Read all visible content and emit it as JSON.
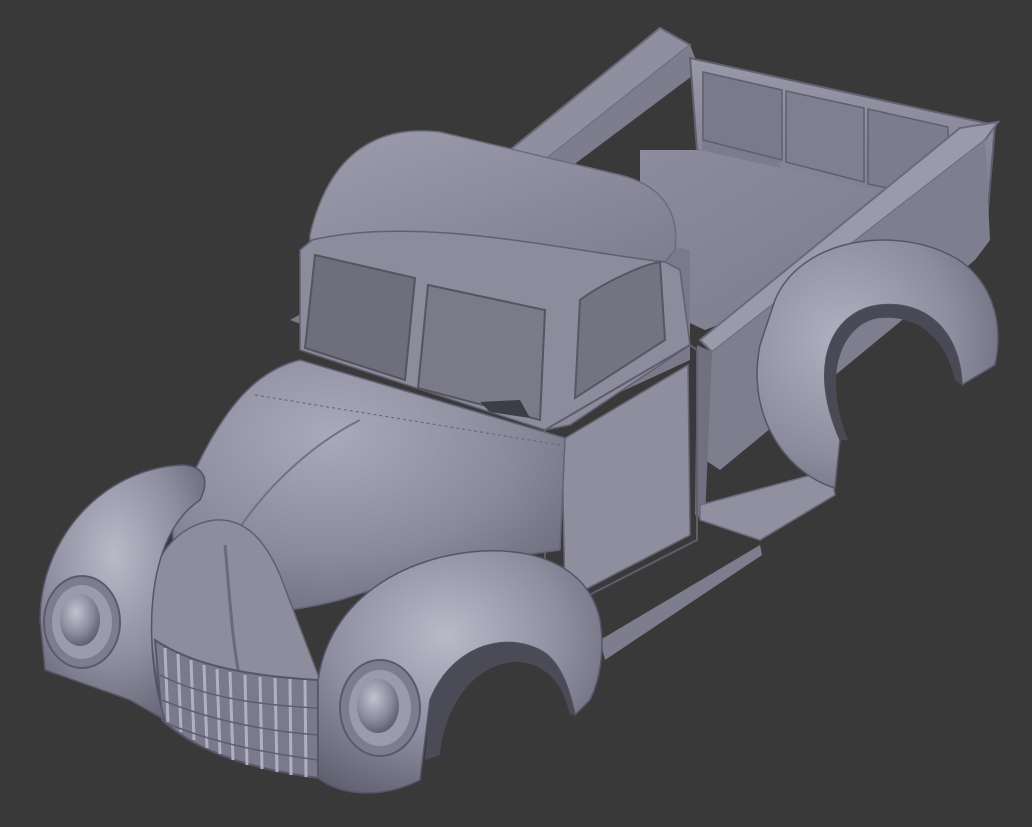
{
  "viewport": {
    "background_color": "#393939",
    "model": "vintage-pickup-truck-body",
    "shading": "solid-matcap",
    "colors": {
      "body": "#8a8a9c",
      "body_light": "#b4b4c4",
      "body_dark": "#5c5c6c",
      "glass_interior": "#6f6f7c"
    }
  }
}
